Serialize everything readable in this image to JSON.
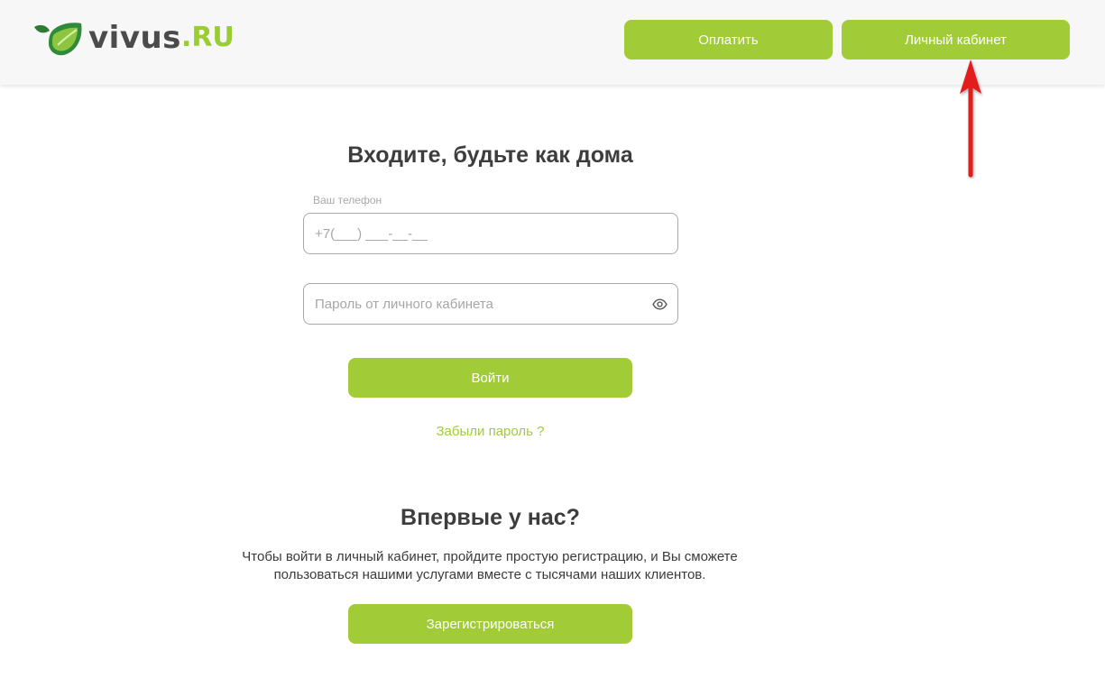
{
  "brand": {
    "name": "vivus",
    "tld": ".RU",
    "accent": "#a1cc37",
    "logo_icon": "leaf-logo-icon"
  },
  "header": {
    "pay_label": "Оплатить",
    "cabinet_label": "Личный кабинет"
  },
  "annotation": {
    "arrow_color": "#e31b1b",
    "arrow_icon": "red-arrow-up-icon"
  },
  "login": {
    "title": "Входите, будьте как дома",
    "phone_label": "Ваш телефон",
    "phone_placeholder": "+7(___) ___-__-__",
    "password_placeholder": "Пароль от личного кабинета",
    "password_toggle_icon": "eye-icon",
    "submit_label": "Войти",
    "forgot_label": "Забыли пароль ?"
  },
  "register": {
    "title": "Впервые у нас?",
    "text": "Чтобы войти в личный кабинет, пройдите простую регистрацию, и Вы сможете пользоваться нашими услугами вместе с тысячами наших клиентов.",
    "button_label": "Зарегистрироваться"
  }
}
